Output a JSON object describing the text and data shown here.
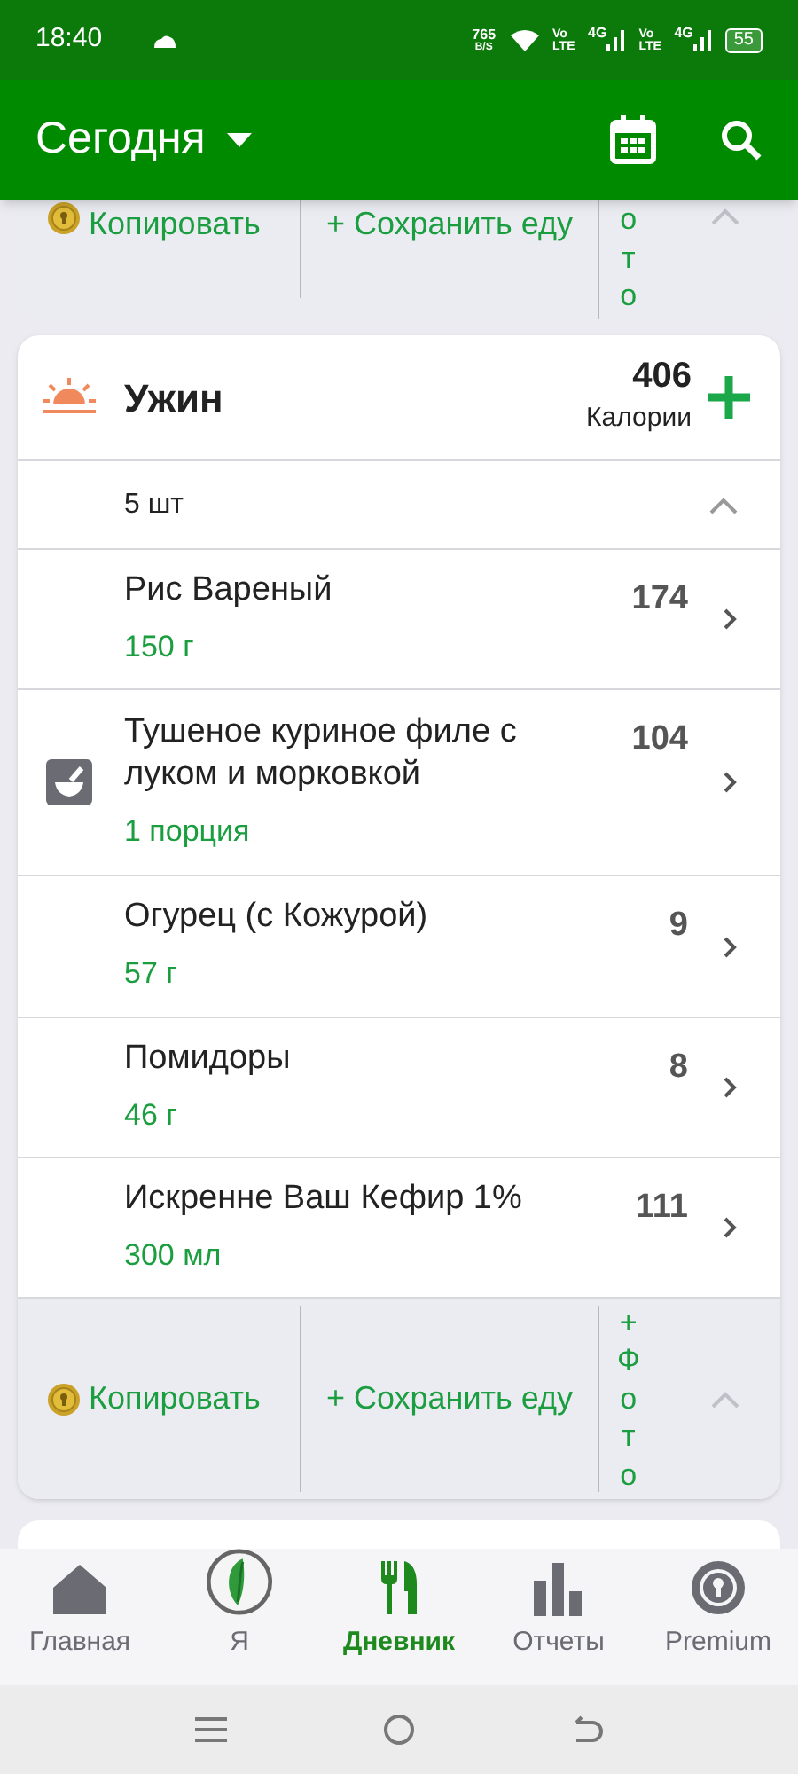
{
  "status_bar": {
    "time": "18:40",
    "speed": "765",
    "speed_unit": "B/S",
    "volte_1": "Vo LTE",
    "net_1": "4G",
    "volte_2": "Vo LTE",
    "net_2": "4G",
    "battery": "55"
  },
  "header": {
    "title": "Сегодня"
  },
  "previous_meal_footer": {
    "copy": "Копировать",
    "save": "+ Сохранить еду",
    "photo": "ото"
  },
  "meal": {
    "name": "Ужин",
    "calories": "406",
    "calories_label": "Калории",
    "count": "5 шт",
    "expanded": true,
    "items": [
      {
        "name": "Рис Вареный",
        "amount": "150 г",
        "calories": "174",
        "recipe": false
      },
      {
        "name": "Тушеное куриное филе с луком и морковкой",
        "amount": "1 порция",
        "calories": "104",
        "recipe": true
      },
      {
        "name": "Огурец (с Кожурой)",
        "amount": "57 г",
        "calories": "9",
        "recipe": false
      },
      {
        "name": "Помидоры",
        "amount": "46 г",
        "calories": "8",
        "recipe": false
      },
      {
        "name": "Искренне Ваш Кефир 1%",
        "amount": "300 мл",
        "calories": "111",
        "recipe": false
      }
    ],
    "footer": {
      "copy": "Копировать",
      "save": "+ Сохранить еду",
      "photo": "+ Фото"
    }
  },
  "bottom_nav": [
    {
      "kind": "home",
      "label": "Главная",
      "selected": false
    },
    {
      "kind": "me",
      "label": "Я",
      "selected": false
    },
    {
      "kind": "diary",
      "label": "Дневник",
      "selected": true
    },
    {
      "kind": "reports",
      "label": "Отчеты",
      "selected": false
    },
    {
      "kind": "premium",
      "label": "Premium",
      "selected": false
    }
  ]
}
